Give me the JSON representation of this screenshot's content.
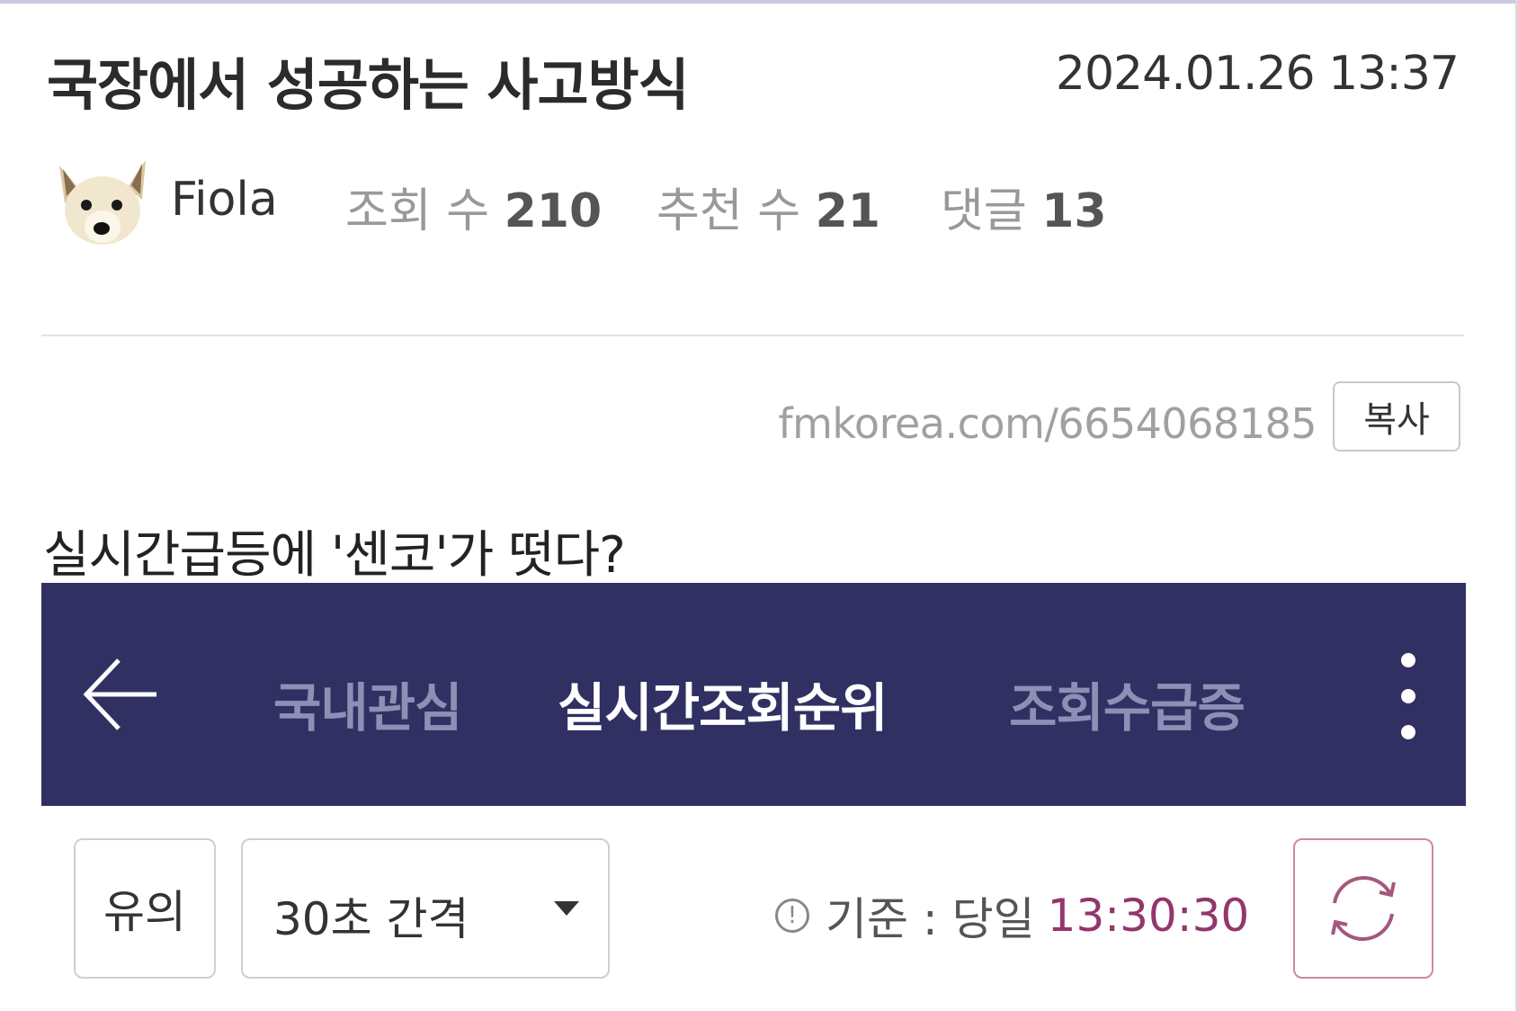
{
  "post": {
    "title": "국장에서 성공하는 사고방식",
    "datetime": "2024.01.26 13:37",
    "author": "Fiola",
    "views_label": "조회 수",
    "views": "210",
    "recommends_label": "추천 수",
    "recommends": "21",
    "comments_label": "댓글",
    "comments": "13",
    "url": "fmkorea.com/6654068185",
    "copy_label": "복사",
    "body_text": "실시간급등에 '센코'가 떳다?"
  },
  "app_screenshot": {
    "tabs": [
      {
        "label": "국내관심",
        "active": false
      },
      {
        "label": "실시간조회순위",
        "active": true
      },
      {
        "label": "조회수급증",
        "active": false
      }
    ],
    "note_button": "유의",
    "interval_select": "30초 간격",
    "basis_label": "기준 : 당일",
    "basis_time": "13:30:30",
    "info_glyph": "!"
  },
  "colors": {
    "app_bar": "#313063",
    "accent_time": "#93366b",
    "refresh_border": "#c98aa8"
  },
  "icons": [
    "dog-avatar",
    "back-arrow-icon",
    "kebab-menu-icon",
    "caret-down-icon",
    "info-icon",
    "refresh-icon"
  ]
}
